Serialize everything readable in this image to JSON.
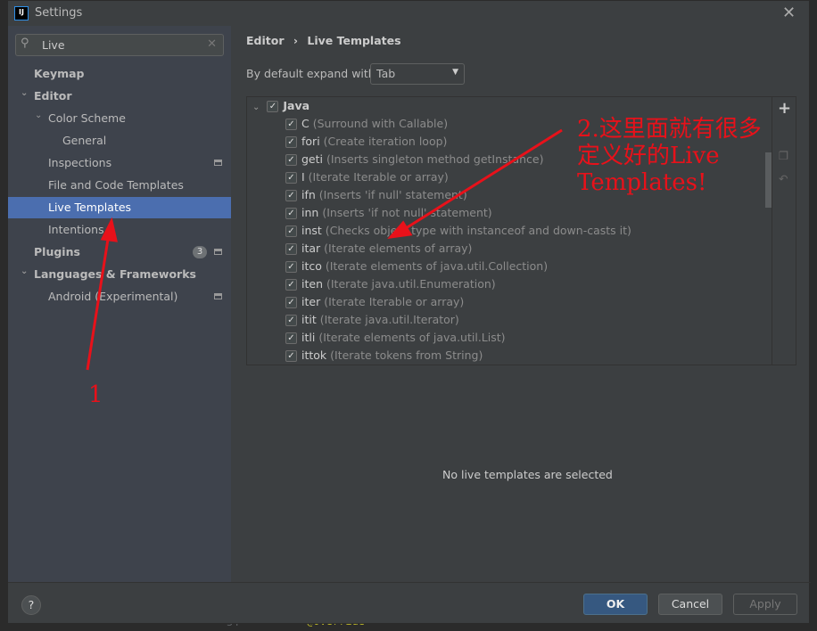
{
  "window": {
    "title": "Settings",
    "app_icon_label": "IJ",
    "close_icon": "close-icon"
  },
  "search": {
    "value": "Live",
    "placeholder": ""
  },
  "sidebar": {
    "items": [
      {
        "label": "Keymap",
        "bold": true,
        "indent": 0
      },
      {
        "label": "Editor",
        "bold": true,
        "indent": 0,
        "expanded": true
      },
      {
        "label": "Color Scheme",
        "indent": 1,
        "expanded": true
      },
      {
        "label": "General",
        "indent": 2
      },
      {
        "label": "Inspections",
        "indent": 1,
        "marker": true
      },
      {
        "label": "File and Code Templates",
        "indent": 1
      },
      {
        "label": "Live Templates",
        "indent": 1,
        "selected": true
      },
      {
        "label": "Intentions",
        "indent": 1
      },
      {
        "label": "Plugins",
        "bold": true,
        "indent": 0,
        "badge": "3",
        "marker": true
      },
      {
        "label": "Languages & Frameworks",
        "bold": true,
        "indent": 0,
        "expanded": true
      },
      {
        "label": "Android (Experimental)",
        "indent": 1,
        "marker": true
      }
    ]
  },
  "breadcrumb": {
    "parent": "Editor",
    "separator": "›",
    "current": "Live Templates"
  },
  "expand": {
    "label": "By default expand with",
    "value": "Tab"
  },
  "templates": {
    "group": "Java",
    "group_checked": true,
    "items": [
      {
        "abbr": "C",
        "desc": "(Surround with Callable)"
      },
      {
        "abbr": "fori",
        "desc": "(Create iteration loop)"
      },
      {
        "abbr": "geti",
        "desc": "(Inserts singleton method getInstance)"
      },
      {
        "abbr": "I",
        "desc": "(Iterate Iterable or array)"
      },
      {
        "abbr": "ifn",
        "desc": "(Inserts 'if null' statement)"
      },
      {
        "abbr": "inn",
        "desc": "(Inserts 'if not null' statement)"
      },
      {
        "abbr": "inst",
        "desc": "(Checks object type with instanceof and down-casts it)"
      },
      {
        "abbr": "itar",
        "desc": "(Iterate elements of array)"
      },
      {
        "abbr": "itco",
        "desc": "(Iterate elements of java.util.Collection)"
      },
      {
        "abbr": "iten",
        "desc": "(Iterate java.util.Enumeration)"
      },
      {
        "abbr": "iter",
        "desc": "(Iterate Iterable or array)"
      },
      {
        "abbr": "itit",
        "desc": "(Iterate java.util.Iterator)"
      },
      {
        "abbr": "itli",
        "desc": "(Iterate elements of java.util.List)"
      },
      {
        "abbr": "ittok",
        "desc": "(Iterate tokens from String)"
      }
    ]
  },
  "toolbar": {
    "add": "+",
    "copy_icon": "copy-icon",
    "revert_icon": "undo-icon"
  },
  "empty_message": "No live templates are selected",
  "footer": {
    "help": "?",
    "ok": "OK",
    "cancel": "Cancel",
    "apply": "Apply"
  },
  "background_editor": {
    "line_number": "34",
    "code": "@Override"
  },
  "annotations": {
    "color": "#e8111a",
    "label1": "1",
    "label2_line1": "2.这里面就有很多",
    "label2_line2": "定义好的Live",
    "label2_line3": "Templates!"
  }
}
